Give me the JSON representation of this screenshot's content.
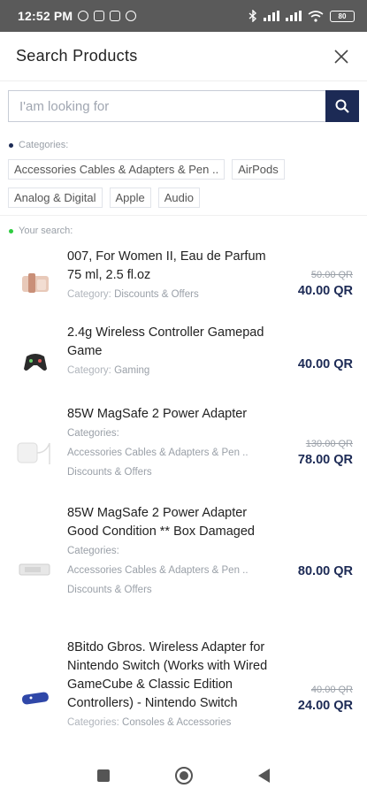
{
  "status_bar": {
    "time": "12:52 PM",
    "left_icons": [
      "alarm-icon",
      "calendar-icon",
      "gallery-icon",
      "notification-icon"
    ],
    "right_icons": [
      "bluetooth-icon",
      "signal-icon",
      "signal-icon",
      "wifi-icon"
    ],
    "battery": "80"
  },
  "header": {
    "title": "Search Products",
    "close_icon": "close-icon"
  },
  "search": {
    "placeholder": "I'am looking for",
    "value": "",
    "button_icon": "search-icon"
  },
  "categories_label": "Categories:",
  "categories": [
    [
      "Accessories Cables & Adapters & Pen ..",
      "AirPods"
    ],
    [
      "Analog & Digital",
      "Apple",
      "Audio"
    ]
  ],
  "your_search_label": "Your search:",
  "results": [
    {
      "name": "007, For Women II, Eau de Parfum 75 ml, 2.5 fl.oz",
      "cat_label": "Category:",
      "cat_lines": [
        "Discounts & Offers"
      ],
      "old_price": "50.00 QR",
      "price": "40.00 QR"
    },
    {
      "name": "2.4g Wireless Controller Gamepad Game",
      "cat_label": "Category:",
      "cat_lines": [
        "Gaming"
      ],
      "old_price": "",
      "price": "40.00 QR"
    },
    {
      "name": "85W MagSafe 2 Power Adapter",
      "cat_label": "Categories:",
      "cat_lines": [
        "Accessories Cables & Adapters & Pen ..",
        "Discounts & Offers"
      ],
      "old_price": "130.00 QR",
      "price": "78.00 QR"
    },
    {
      "name": "85W MagSafe 2 Power Adapter Good Condition ** Box Damaged",
      "cat_label": "Categories:",
      "cat_lines": [
        "Accessories Cables & Adapters & Pen ..",
        "Discounts & Offers"
      ],
      "old_price": "",
      "price": "80.00 QR"
    },
    {
      "name": "8Bitdo Gbros. Wireless Adapter for Nintendo Switch (Works with Wired GameCube & Classic Edition Controllers) - Nintendo Switch",
      "cat_label": "Categories:",
      "cat_lines": [
        "Consoles & Accessories"
      ],
      "old_price": "40.00 QR",
      "price": "24.00 QR"
    }
  ],
  "colors": {
    "accent": "#1c2a55",
    "status_bar": "#5a5a5a",
    "green_dot": "#2ecc40"
  }
}
